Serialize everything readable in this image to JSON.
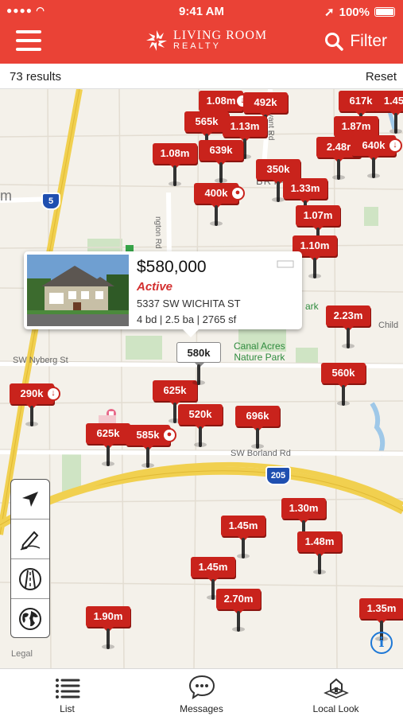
{
  "status_bar": {
    "time": "9:41 AM",
    "battery": "100%"
  },
  "header": {
    "logo_line1": "LIVING ROOM",
    "logo_line2": "REALTY",
    "filter_label": "Filter"
  },
  "results": {
    "count": "73 results",
    "reset_label": "Reset"
  },
  "map": {
    "labels": [
      {
        "text": "m"
      },
      {
        "text": "SW Nyberg St"
      },
      {
        "text": "SW Borland Rd"
      },
      {
        "text": "BRYAN"
      },
      {
        "text": "Child"
      },
      {
        "text": "ark"
      },
      {
        "text": "ngton Rd"
      },
      {
        "text": "Bryant Rd"
      }
    ],
    "shields": [
      {
        "text": "5"
      },
      {
        "text": "205"
      }
    ],
    "park": {
      "line1": "Canal Acres",
      "line2": "Nature Park"
    },
    "pins": [
      {
        "label": "1.08m"
      },
      {
        "label": "492k"
      },
      {
        "label": "565k"
      },
      {
        "label": "1.13m"
      },
      {
        "label": "617k"
      },
      {
        "label": "1.45r"
      },
      {
        "label": "1.87m"
      },
      {
        "label": "1.08m"
      },
      {
        "label": "639k"
      },
      {
        "label": "2.48r"
      },
      {
        "label": "640k"
      },
      {
        "label": "350k"
      },
      {
        "label": "400k"
      },
      {
        "label": "1.33m"
      },
      {
        "label": "1.07m"
      },
      {
        "label": "1.10m"
      },
      {
        "label": "2.23m"
      },
      {
        "label": "560k"
      },
      {
        "label": "290k"
      },
      {
        "label": "625k"
      },
      {
        "label": "520k"
      },
      {
        "label": "696k"
      },
      {
        "label": "625k"
      },
      {
        "label": "585k"
      },
      {
        "label": "1.30m"
      },
      {
        "label": "1.45m"
      },
      {
        "label": "1.48m"
      },
      {
        "label": "1.45m"
      },
      {
        "label": "2.70m"
      },
      {
        "label": "1.90m"
      },
      {
        "label": "1.35m"
      },
      {
        "label": "580k"
      }
    ]
  },
  "popup": {
    "price": "$580,000",
    "status": "Active",
    "address": "5337 SW WICHITA ST",
    "specs": "4 bd | 2.5 ba | 2765 sf"
  },
  "legal": "Legal",
  "tabs": [
    {
      "label": "List",
      "icon": "list-icon"
    },
    {
      "label": "Messages",
      "icon": "messages-icon"
    },
    {
      "label": "Local Look",
      "icon": "local-look-icon"
    }
  ],
  "colors": {
    "brand": "#ea4236",
    "pin": "#c9231c",
    "status_active": "#d32f2f",
    "info": "#1e78d6"
  }
}
